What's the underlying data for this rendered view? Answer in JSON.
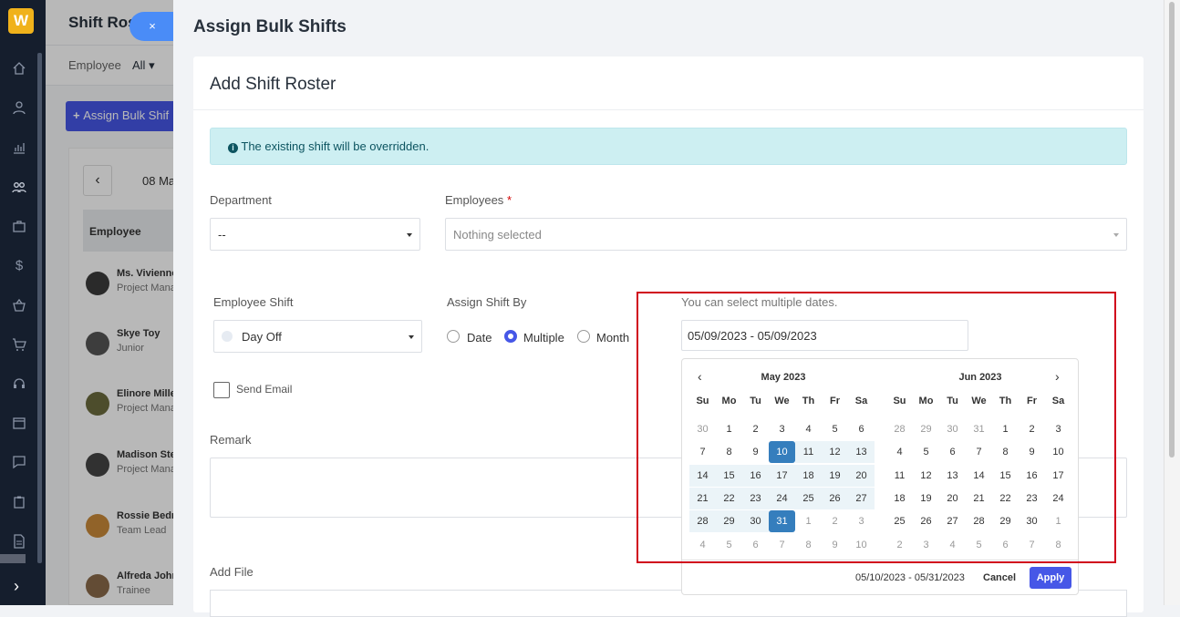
{
  "sidebar": {
    "logo": "W",
    "collapse": "›"
  },
  "background": {
    "title": "Shift Rost",
    "filter_label": "Employee",
    "filter_value": "All",
    "assign_button": "Assign Bulk Shif",
    "week_label": "08 Ma",
    "table_header": "Employee",
    "employees": [
      {
        "name": "Ms. Vivienne",
        "role": "Project Mana"
      },
      {
        "name": "Skye Toy",
        "role": "Junior"
      },
      {
        "name": "Elinore Miller",
        "role": "Project Mana"
      },
      {
        "name": "Madison Ste",
        "role": "Project Mana"
      },
      {
        "name": "Rossie Bedn",
        "role": "Team Lead"
      },
      {
        "name": "Alfreda John",
        "role": "Trainee"
      }
    ]
  },
  "modal": {
    "close_label": "×",
    "title": "Assign Bulk Shifts",
    "card_title": "Add Shift Roster",
    "alert": "The existing shift will be overridden.",
    "department": {
      "label": "Department",
      "value": "--"
    },
    "employees": {
      "label": "Employees",
      "required": "*",
      "placeholder": "Nothing selected"
    },
    "employee_shift": {
      "label": "Employee Shift",
      "value": "Day Off"
    },
    "assign_by": {
      "label": "Assign Shift By",
      "options": [
        "Date",
        "Multiple",
        "Month"
      ],
      "selected": "Multiple"
    },
    "dates": {
      "hint": "You can select multiple dates.",
      "value": "05/09/2023 - 05/09/2023"
    },
    "send_email": "Send Email",
    "remark": "Remark",
    "add_file": "Add File"
  },
  "datepicker": {
    "prev": "‹",
    "next": "›",
    "dow": [
      "Su",
      "Mo",
      "Tu",
      "We",
      "Th",
      "Fr",
      "Sa"
    ],
    "left_month": "May 2023",
    "right_month": "Jun 2023",
    "left_days": [
      "30",
      "1",
      "2",
      "3",
      "4",
      "5",
      "6",
      "7",
      "8",
      "9",
      "10",
      "11",
      "12",
      "13",
      "14",
      "15",
      "16",
      "17",
      "18",
      "19",
      "20",
      "21",
      "22",
      "23",
      "24",
      "25",
      "26",
      "27",
      "28",
      "29",
      "30",
      "31",
      "1",
      "2",
      "3",
      "4",
      "5",
      "6",
      "7",
      "8",
      "9",
      "10"
    ],
    "right_days": [
      "28",
      "29",
      "30",
      "31",
      "1",
      "2",
      "3",
      "4",
      "5",
      "6",
      "7",
      "8",
      "9",
      "10",
      "11",
      "12",
      "13",
      "14",
      "15",
      "16",
      "17",
      "18",
      "19",
      "20",
      "21",
      "22",
      "23",
      "24",
      "25",
      "26",
      "27",
      "28",
      "29",
      "30",
      "1",
      "2",
      "3",
      "4",
      "5",
      "6",
      "7",
      "8"
    ],
    "range_text": "05/10/2023 - 05/31/2023",
    "cancel": "Cancel",
    "apply": "Apply"
  }
}
